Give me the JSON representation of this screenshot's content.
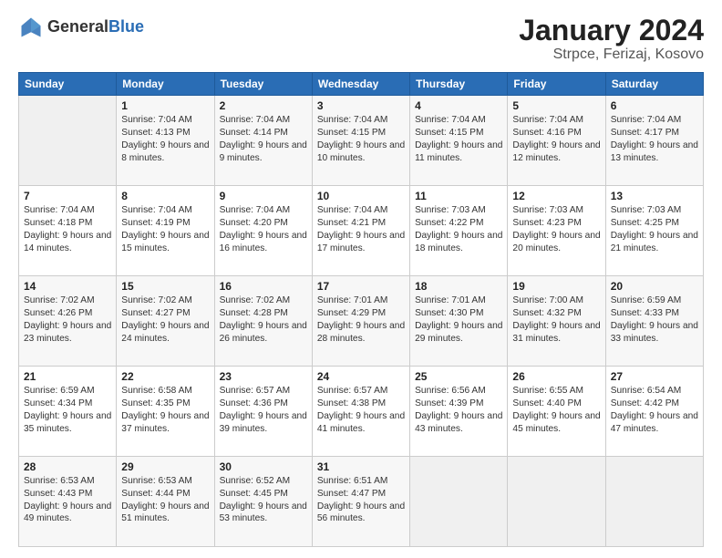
{
  "header": {
    "logo_general": "General",
    "logo_blue": "Blue",
    "title": "January 2024",
    "subtitle": "Strpce, Ferizaj, Kosovo"
  },
  "weekdays": [
    "Sunday",
    "Monday",
    "Tuesday",
    "Wednesday",
    "Thursday",
    "Friday",
    "Saturday"
  ],
  "weeks": [
    [
      {
        "day": "",
        "sunrise": "",
        "sunset": "",
        "daylight": ""
      },
      {
        "day": "1",
        "sunrise": "Sunrise: 7:04 AM",
        "sunset": "Sunset: 4:13 PM",
        "daylight": "Daylight: 9 hours and 8 minutes."
      },
      {
        "day": "2",
        "sunrise": "Sunrise: 7:04 AM",
        "sunset": "Sunset: 4:14 PM",
        "daylight": "Daylight: 9 hours and 9 minutes."
      },
      {
        "day": "3",
        "sunrise": "Sunrise: 7:04 AM",
        "sunset": "Sunset: 4:15 PM",
        "daylight": "Daylight: 9 hours and 10 minutes."
      },
      {
        "day": "4",
        "sunrise": "Sunrise: 7:04 AM",
        "sunset": "Sunset: 4:15 PM",
        "daylight": "Daylight: 9 hours and 11 minutes."
      },
      {
        "day": "5",
        "sunrise": "Sunrise: 7:04 AM",
        "sunset": "Sunset: 4:16 PM",
        "daylight": "Daylight: 9 hours and 12 minutes."
      },
      {
        "day": "6",
        "sunrise": "Sunrise: 7:04 AM",
        "sunset": "Sunset: 4:17 PM",
        "daylight": "Daylight: 9 hours and 13 minutes."
      }
    ],
    [
      {
        "day": "7",
        "sunrise": "Sunrise: 7:04 AM",
        "sunset": "Sunset: 4:18 PM",
        "daylight": "Daylight: 9 hours and 14 minutes."
      },
      {
        "day": "8",
        "sunrise": "Sunrise: 7:04 AM",
        "sunset": "Sunset: 4:19 PM",
        "daylight": "Daylight: 9 hours and 15 minutes."
      },
      {
        "day": "9",
        "sunrise": "Sunrise: 7:04 AM",
        "sunset": "Sunset: 4:20 PM",
        "daylight": "Daylight: 9 hours and 16 minutes."
      },
      {
        "day": "10",
        "sunrise": "Sunrise: 7:04 AM",
        "sunset": "Sunset: 4:21 PM",
        "daylight": "Daylight: 9 hours and 17 minutes."
      },
      {
        "day": "11",
        "sunrise": "Sunrise: 7:03 AM",
        "sunset": "Sunset: 4:22 PM",
        "daylight": "Daylight: 9 hours and 18 minutes."
      },
      {
        "day": "12",
        "sunrise": "Sunrise: 7:03 AM",
        "sunset": "Sunset: 4:23 PM",
        "daylight": "Daylight: 9 hours and 20 minutes."
      },
      {
        "day": "13",
        "sunrise": "Sunrise: 7:03 AM",
        "sunset": "Sunset: 4:25 PM",
        "daylight": "Daylight: 9 hours and 21 minutes."
      }
    ],
    [
      {
        "day": "14",
        "sunrise": "Sunrise: 7:02 AM",
        "sunset": "Sunset: 4:26 PM",
        "daylight": "Daylight: 9 hours and 23 minutes."
      },
      {
        "day": "15",
        "sunrise": "Sunrise: 7:02 AM",
        "sunset": "Sunset: 4:27 PM",
        "daylight": "Daylight: 9 hours and 24 minutes."
      },
      {
        "day": "16",
        "sunrise": "Sunrise: 7:02 AM",
        "sunset": "Sunset: 4:28 PM",
        "daylight": "Daylight: 9 hours and 26 minutes."
      },
      {
        "day": "17",
        "sunrise": "Sunrise: 7:01 AM",
        "sunset": "Sunset: 4:29 PM",
        "daylight": "Daylight: 9 hours and 28 minutes."
      },
      {
        "day": "18",
        "sunrise": "Sunrise: 7:01 AM",
        "sunset": "Sunset: 4:30 PM",
        "daylight": "Daylight: 9 hours and 29 minutes."
      },
      {
        "day": "19",
        "sunrise": "Sunrise: 7:00 AM",
        "sunset": "Sunset: 4:32 PM",
        "daylight": "Daylight: 9 hours and 31 minutes."
      },
      {
        "day": "20",
        "sunrise": "Sunrise: 6:59 AM",
        "sunset": "Sunset: 4:33 PM",
        "daylight": "Daylight: 9 hours and 33 minutes."
      }
    ],
    [
      {
        "day": "21",
        "sunrise": "Sunrise: 6:59 AM",
        "sunset": "Sunset: 4:34 PM",
        "daylight": "Daylight: 9 hours and 35 minutes."
      },
      {
        "day": "22",
        "sunrise": "Sunrise: 6:58 AM",
        "sunset": "Sunset: 4:35 PM",
        "daylight": "Daylight: 9 hours and 37 minutes."
      },
      {
        "day": "23",
        "sunrise": "Sunrise: 6:57 AM",
        "sunset": "Sunset: 4:36 PM",
        "daylight": "Daylight: 9 hours and 39 minutes."
      },
      {
        "day": "24",
        "sunrise": "Sunrise: 6:57 AM",
        "sunset": "Sunset: 4:38 PM",
        "daylight": "Daylight: 9 hours and 41 minutes."
      },
      {
        "day": "25",
        "sunrise": "Sunrise: 6:56 AM",
        "sunset": "Sunset: 4:39 PM",
        "daylight": "Daylight: 9 hours and 43 minutes."
      },
      {
        "day": "26",
        "sunrise": "Sunrise: 6:55 AM",
        "sunset": "Sunset: 4:40 PM",
        "daylight": "Daylight: 9 hours and 45 minutes."
      },
      {
        "day": "27",
        "sunrise": "Sunrise: 6:54 AM",
        "sunset": "Sunset: 4:42 PM",
        "daylight": "Daylight: 9 hours and 47 minutes."
      }
    ],
    [
      {
        "day": "28",
        "sunrise": "Sunrise: 6:53 AM",
        "sunset": "Sunset: 4:43 PM",
        "daylight": "Daylight: 9 hours and 49 minutes."
      },
      {
        "day": "29",
        "sunrise": "Sunrise: 6:53 AM",
        "sunset": "Sunset: 4:44 PM",
        "daylight": "Daylight: 9 hours and 51 minutes."
      },
      {
        "day": "30",
        "sunrise": "Sunrise: 6:52 AM",
        "sunset": "Sunset: 4:45 PM",
        "daylight": "Daylight: 9 hours and 53 minutes."
      },
      {
        "day": "31",
        "sunrise": "Sunrise: 6:51 AM",
        "sunset": "Sunset: 4:47 PM",
        "daylight": "Daylight: 9 hours and 56 minutes."
      },
      {
        "day": "",
        "sunrise": "",
        "sunset": "",
        "daylight": ""
      },
      {
        "day": "",
        "sunrise": "",
        "sunset": "",
        "daylight": ""
      },
      {
        "day": "",
        "sunrise": "",
        "sunset": "",
        "daylight": ""
      }
    ]
  ]
}
